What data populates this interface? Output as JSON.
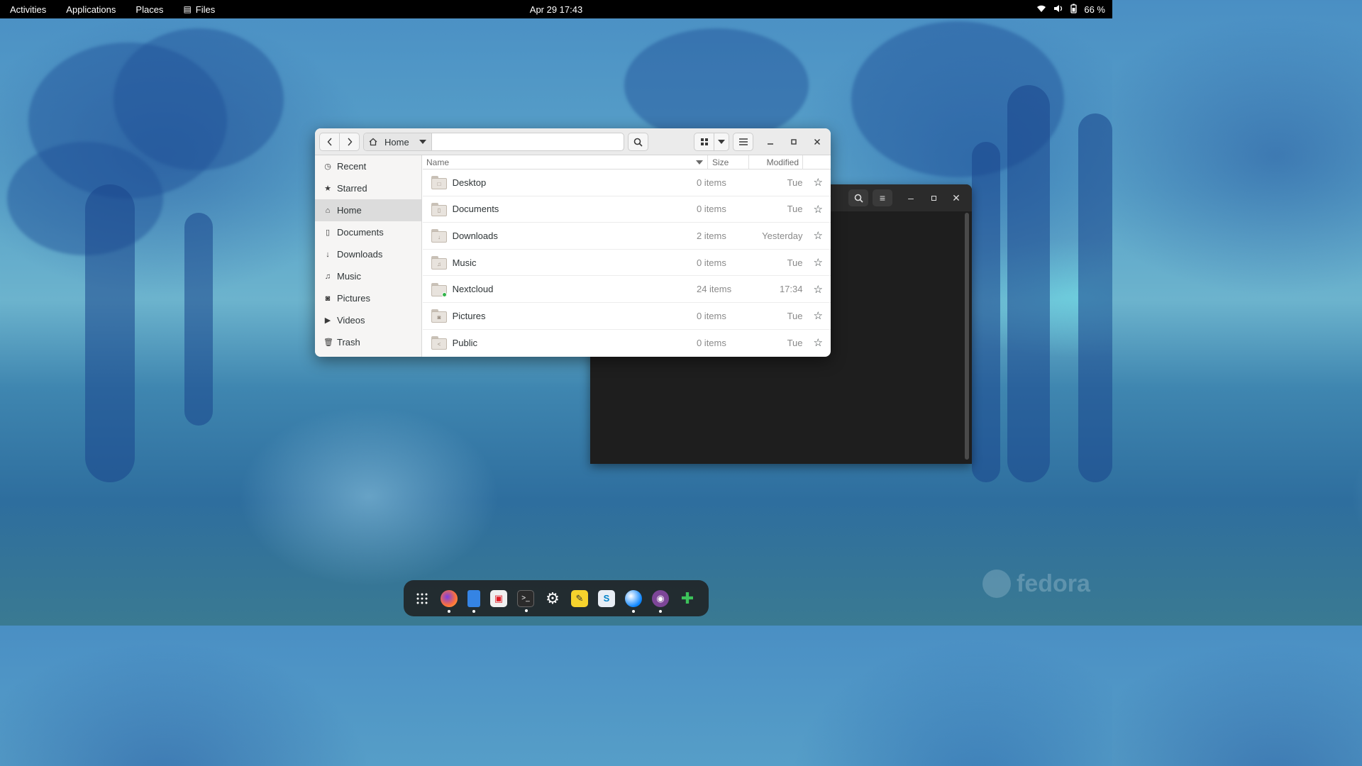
{
  "topbar": {
    "activities": "Activities",
    "applications": "Applications",
    "places": "Places",
    "app_menu": "Files",
    "clock": "Apr 29  17:43",
    "battery": "66 %"
  },
  "files": {
    "location": "Home",
    "sidebar": [
      {
        "label": "Recent",
        "icon": "clock-icon"
      },
      {
        "label": "Starred",
        "icon": "star-icon"
      },
      {
        "label": "Home",
        "icon": "home-icon",
        "selected": true
      },
      {
        "label": "Documents",
        "icon": "document-icon"
      },
      {
        "label": "Downloads",
        "icon": "download-icon"
      },
      {
        "label": "Music",
        "icon": "music-icon"
      },
      {
        "label": "Pictures",
        "icon": "camera-icon"
      },
      {
        "label": "Videos",
        "icon": "video-icon"
      },
      {
        "label": "Trash",
        "icon": "trash-icon"
      }
    ],
    "columns": {
      "name": "Name",
      "size": "Size",
      "modified": "Modified"
    },
    "rows": [
      {
        "name": "Desktop",
        "size": "0 items",
        "modified": "Tue"
      },
      {
        "name": "Documents",
        "size": "0 items",
        "modified": "Tue"
      },
      {
        "name": "Downloads",
        "size": "2 items",
        "modified": "Yesterday"
      },
      {
        "name": "Music",
        "size": "0 items",
        "modified": "Tue"
      },
      {
        "name": "Nextcloud",
        "size": "24 items",
        "modified": "17:34"
      },
      {
        "name": "Pictures",
        "size": "0 items",
        "modified": "Tue"
      },
      {
        "name": "Public",
        "size": "0 items",
        "modified": "Tue"
      }
    ]
  },
  "dock": {
    "apps": [
      "app-grid-icon",
      "firefox-icon",
      "files-icon",
      "software-icon",
      "terminal-icon",
      "settings-icon",
      "text-editor-icon",
      "nextcloud-icon",
      "thunderbird-icon",
      "tor-browser-icon",
      "extensions-icon"
    ]
  },
  "wallpaper_brand": "fedora",
  "colors": {
    "topbar": "#000000",
    "window_bg": "#ffffff",
    "sidebar_selected": "#dcdcdc",
    "terminal_bg": "#1e1e1e"
  }
}
